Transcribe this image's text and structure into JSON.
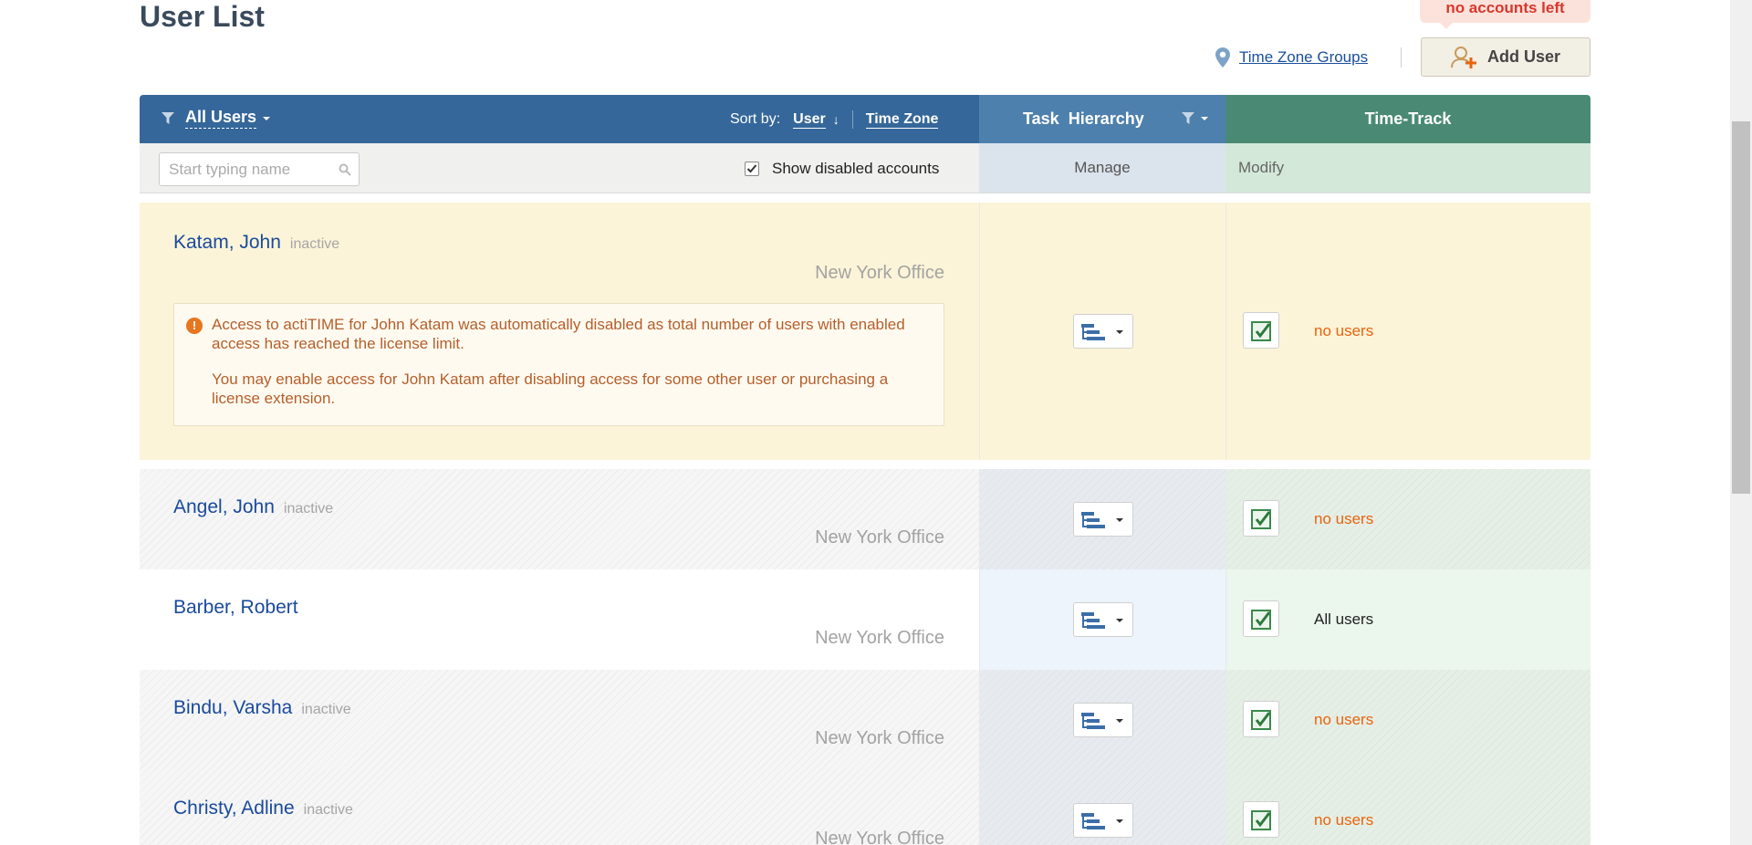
{
  "page": {
    "title": "User List",
    "no_accounts_notice": "no accounts left",
    "tz_groups_link": "Time Zone Groups",
    "add_user_label": "Add User"
  },
  "header": {
    "filter_label": "All Users",
    "sort_by_label": "Sort by:",
    "sort_user": "User",
    "sort_timezone": "Time Zone",
    "task_hierarchy": "Task Hierarchy",
    "time_track": "Time-Track"
  },
  "subheader": {
    "search_placeholder": "Start typing name",
    "show_disabled_label": "Show disabled accounts",
    "show_disabled_checked": true,
    "manage": "Manage",
    "modify": "Modify"
  },
  "users": [
    {
      "name": "Katam, John",
      "status": "inactive",
      "office": "New York Office",
      "time_track": "no users",
      "alert": {
        "line1": "Access to actiTIME for John Katam was automatically disabled as total number of users with enabled access has reached the license limit.",
        "line2": "You may enable access for John Katam after disabling access for some other user or purchasing a license extension."
      }
    },
    {
      "name": "Angel, John",
      "status": "inactive",
      "office": "New York Office",
      "time_track": "no users"
    },
    {
      "name": "Barber, Robert",
      "status": "",
      "office": "New York Office",
      "time_track": "All users"
    },
    {
      "name": "Bindu, Varsha",
      "status": "inactive",
      "office": "New York Office",
      "time_track": "no users"
    },
    {
      "name": "Christy, Adline",
      "status": "inactive",
      "office": "New York Office",
      "time_track": "no users"
    }
  ],
  "colors": {
    "header_main": "#35679a",
    "header_task": "#4d80ad",
    "header_time": "#4a8a74",
    "warning_row": "#fcf4d8",
    "no_users_text": "#e8640f",
    "link_blue": "#1a4a9c"
  }
}
